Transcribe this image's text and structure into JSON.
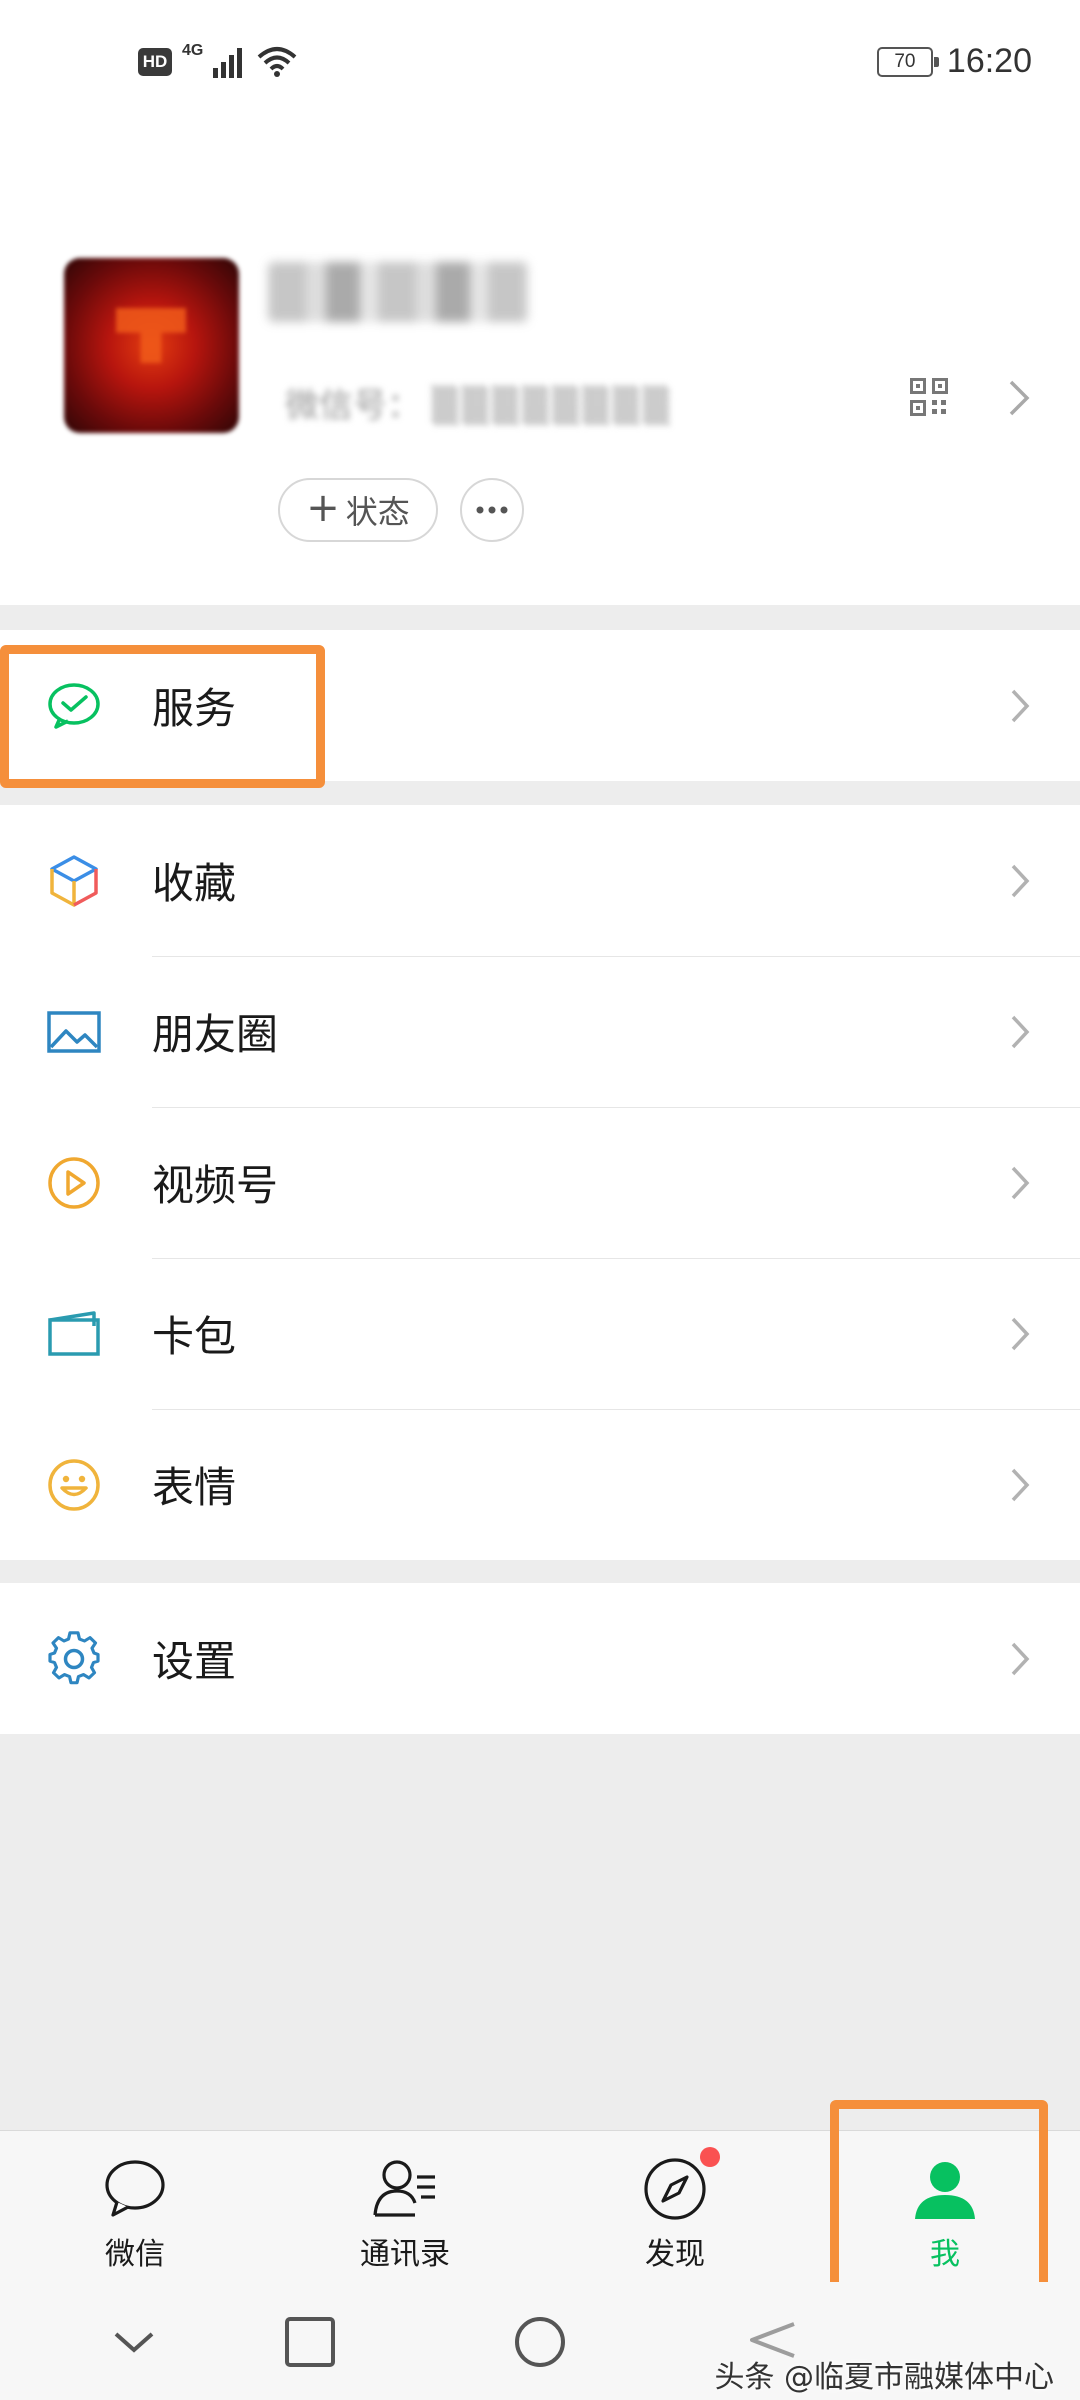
{
  "status_bar": {
    "hd": "HD",
    "network": "4G",
    "battery": "70",
    "time": "16:20"
  },
  "profile": {
    "wechat_id_prefix": "微信号：",
    "status_button": "状态",
    "more_icon": "ellipsis-icon",
    "qr_icon": "qr-code-icon"
  },
  "menu": {
    "service": {
      "label": "服务",
      "icon": "wechat-pay-icon",
      "icon_color": "#07c160"
    },
    "group2": [
      {
        "label": "收藏",
        "icon": "favorites-cube-icon"
      },
      {
        "label": "朋友圈",
        "icon": "moments-image-icon"
      },
      {
        "label": "视频号",
        "icon": "channels-play-icon"
      },
      {
        "label": "卡包",
        "icon": "card-wallet-icon"
      },
      {
        "label": "表情",
        "icon": "sticker-smile-icon"
      }
    ],
    "settings": {
      "label": "设置",
      "icon": "settings-gear-icon"
    }
  },
  "tabbar": {
    "tabs": [
      {
        "label": "微信",
        "icon": "chat-bubble-icon",
        "active": false
      },
      {
        "label": "通讯录",
        "icon": "contacts-icon",
        "active": false
      },
      {
        "label": "发现",
        "icon": "discover-compass-icon",
        "active": false,
        "badge": true
      },
      {
        "label": "我",
        "icon": "me-person-icon",
        "active": true
      }
    ],
    "active_color": "#07c160"
  },
  "highlight_color": "#f58f3b",
  "watermark": "头条 @临夏市融媒体中心"
}
